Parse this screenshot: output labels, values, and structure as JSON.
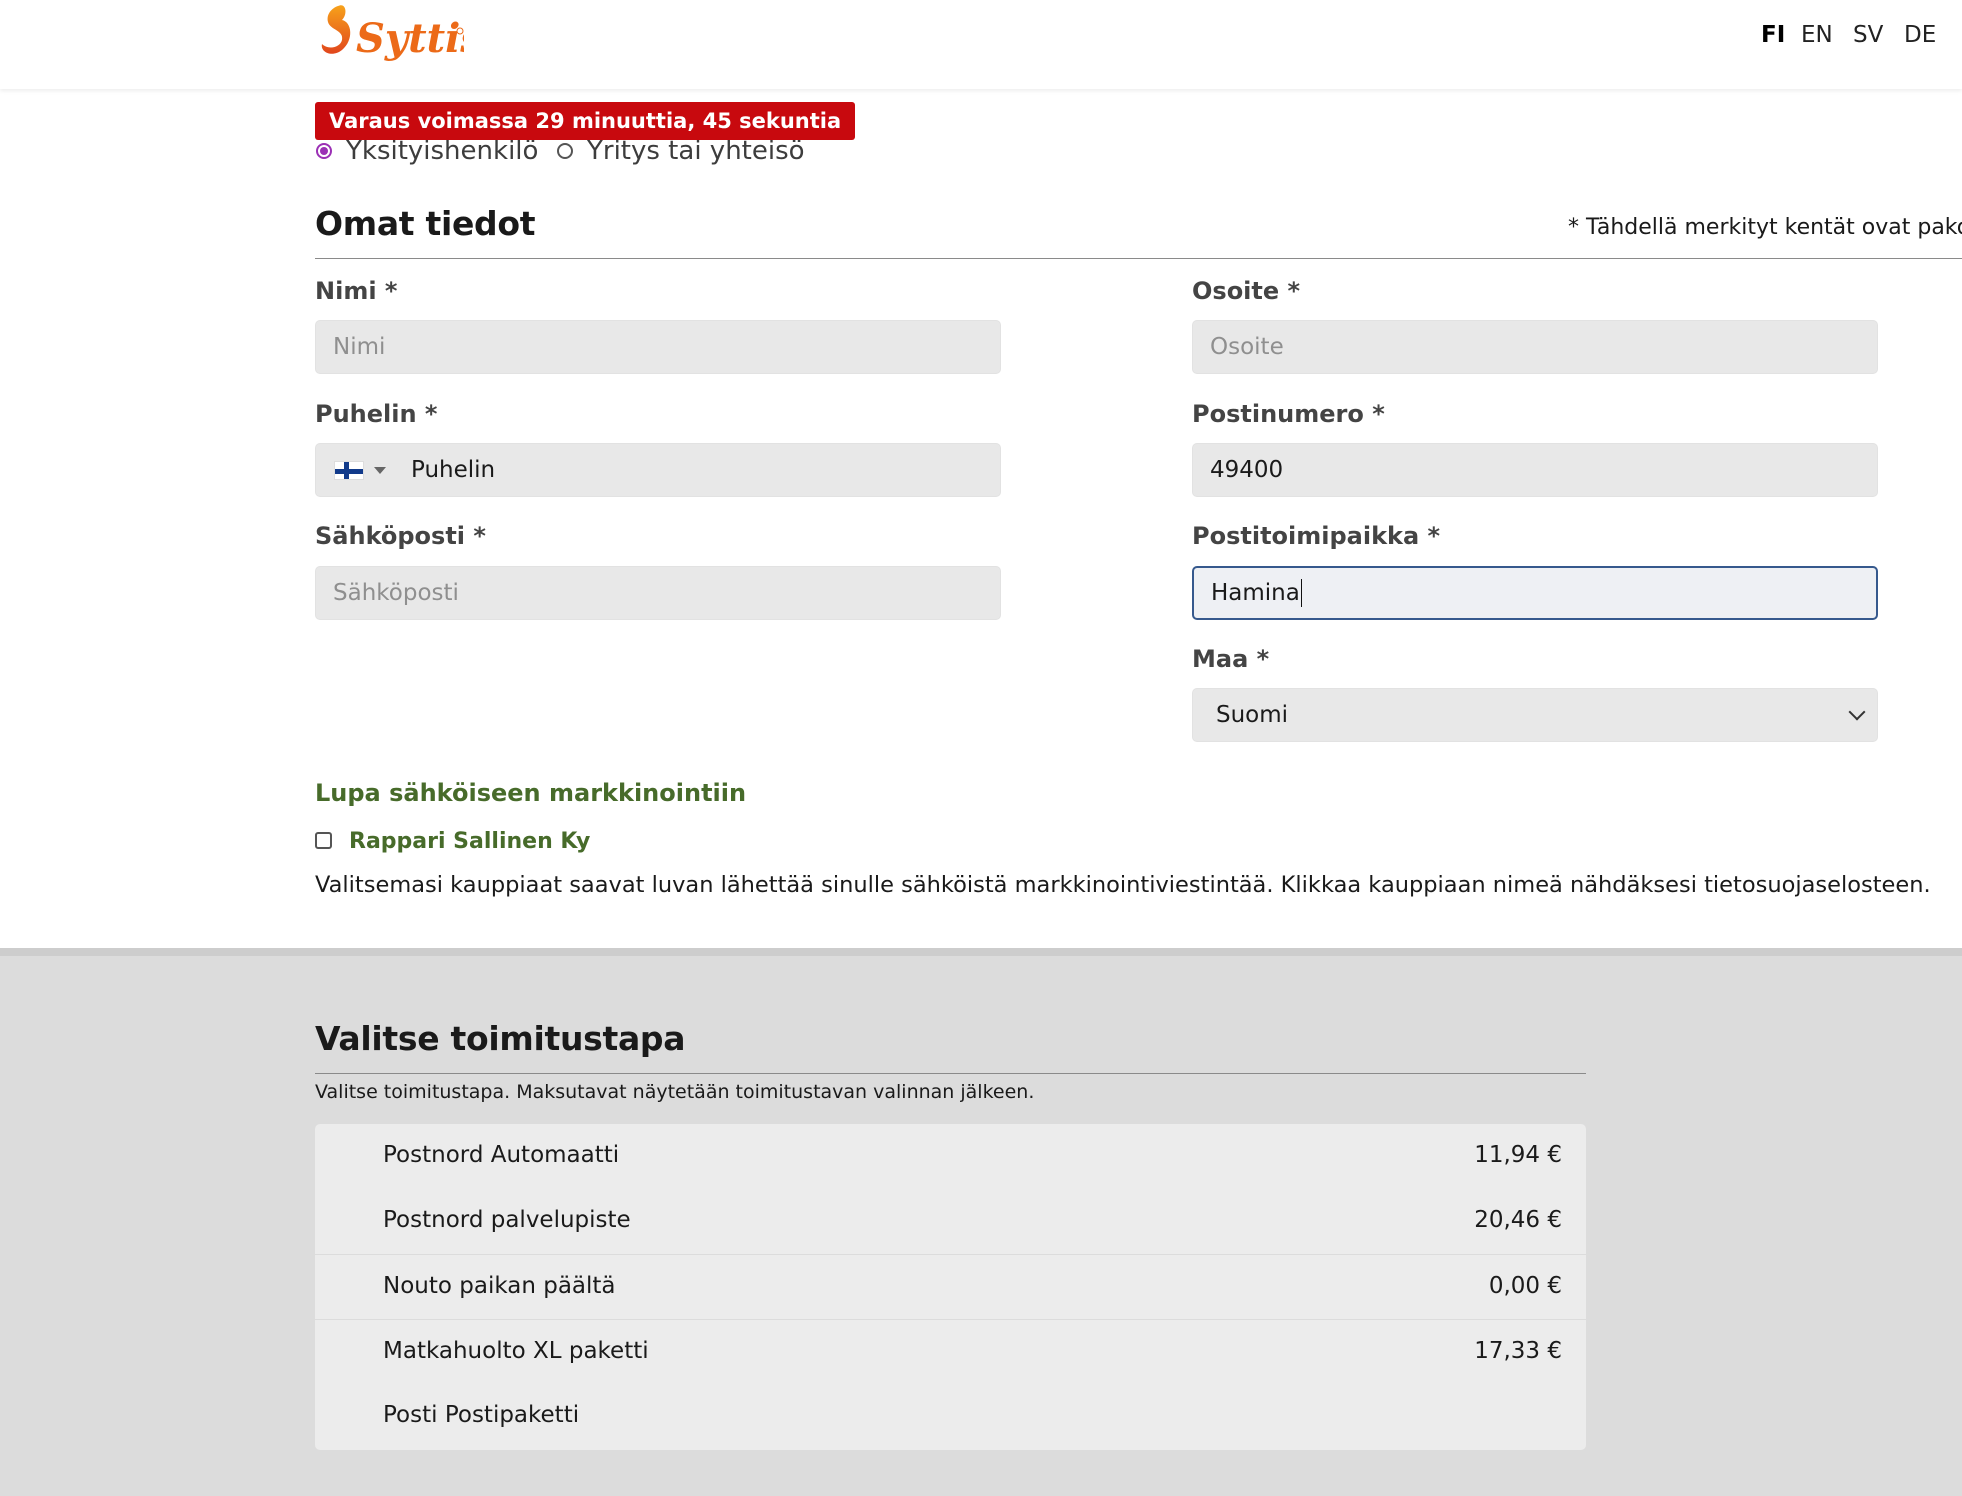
{
  "header": {
    "logo_text": "Syttis",
    "languages": [
      "FI",
      "EN",
      "SV",
      "DE"
    ],
    "active_language": "FI"
  },
  "reservation": {
    "timer_text": "Varaus voimassa 29 minuuttia, 45 sekuntia"
  },
  "customer_type": {
    "options": [
      "Yksityishenkilö",
      "Yritys tai yhteisö"
    ],
    "selected": "Yksityishenkilö"
  },
  "personal": {
    "heading": "Omat tiedot",
    "required_note": "* Tähdellä merkityt kentät ovat pakollisia",
    "fields": {
      "name": {
        "label": "Nimi *",
        "placeholder": "Nimi",
        "value": ""
      },
      "phone": {
        "label": "Puhelin *",
        "placeholder": "Puhelin",
        "value": "",
        "country": "FI"
      },
      "email": {
        "label": "Sähköposti *",
        "placeholder": "Sähköposti",
        "value": ""
      },
      "address": {
        "label": "Osoite *",
        "placeholder": "Osoite",
        "value": ""
      },
      "postal_code": {
        "label": "Postinumero *",
        "value": "49400"
      },
      "city": {
        "label": "Postitoimipaikka *",
        "value": "Hamina"
      },
      "country": {
        "label": "Maa *",
        "value": "Suomi"
      }
    }
  },
  "marketing": {
    "heading": "Lupa sähköiseen markkinointiin",
    "merchant": "Rappari Sallinen Ky",
    "checked": false,
    "description": "Valitsemasi kauppiaat saavat luvan lähettää sinulle sähköistä markkinointiviestintää. Klikkaa kauppiaan nimeä nähdäksesi tietosuojaselosteen."
  },
  "shipping": {
    "heading": "Valitse toimitustapa",
    "description": "Valitse toimitustapa. Maksutavat näytetään toimitustavan valinnan jälkeen.",
    "options": [
      {
        "name": "Postnord Automaatti",
        "price": "11,94 €"
      },
      {
        "name": "Postnord palvelupiste",
        "price": "20,46 €"
      },
      {
        "name": "Nouto paikan päältä",
        "price": "0,00 €"
      },
      {
        "name": "Matkahuolto XL paketti",
        "price": "17,33 €"
      },
      {
        "name": "Posti Postipaketti",
        "price": ""
      }
    ]
  },
  "colors": {
    "timer_bg": "#c8090e",
    "marketing_green": "#476b2a",
    "focus_border": "#36598d",
    "logo_orange": "#ec6a18"
  }
}
